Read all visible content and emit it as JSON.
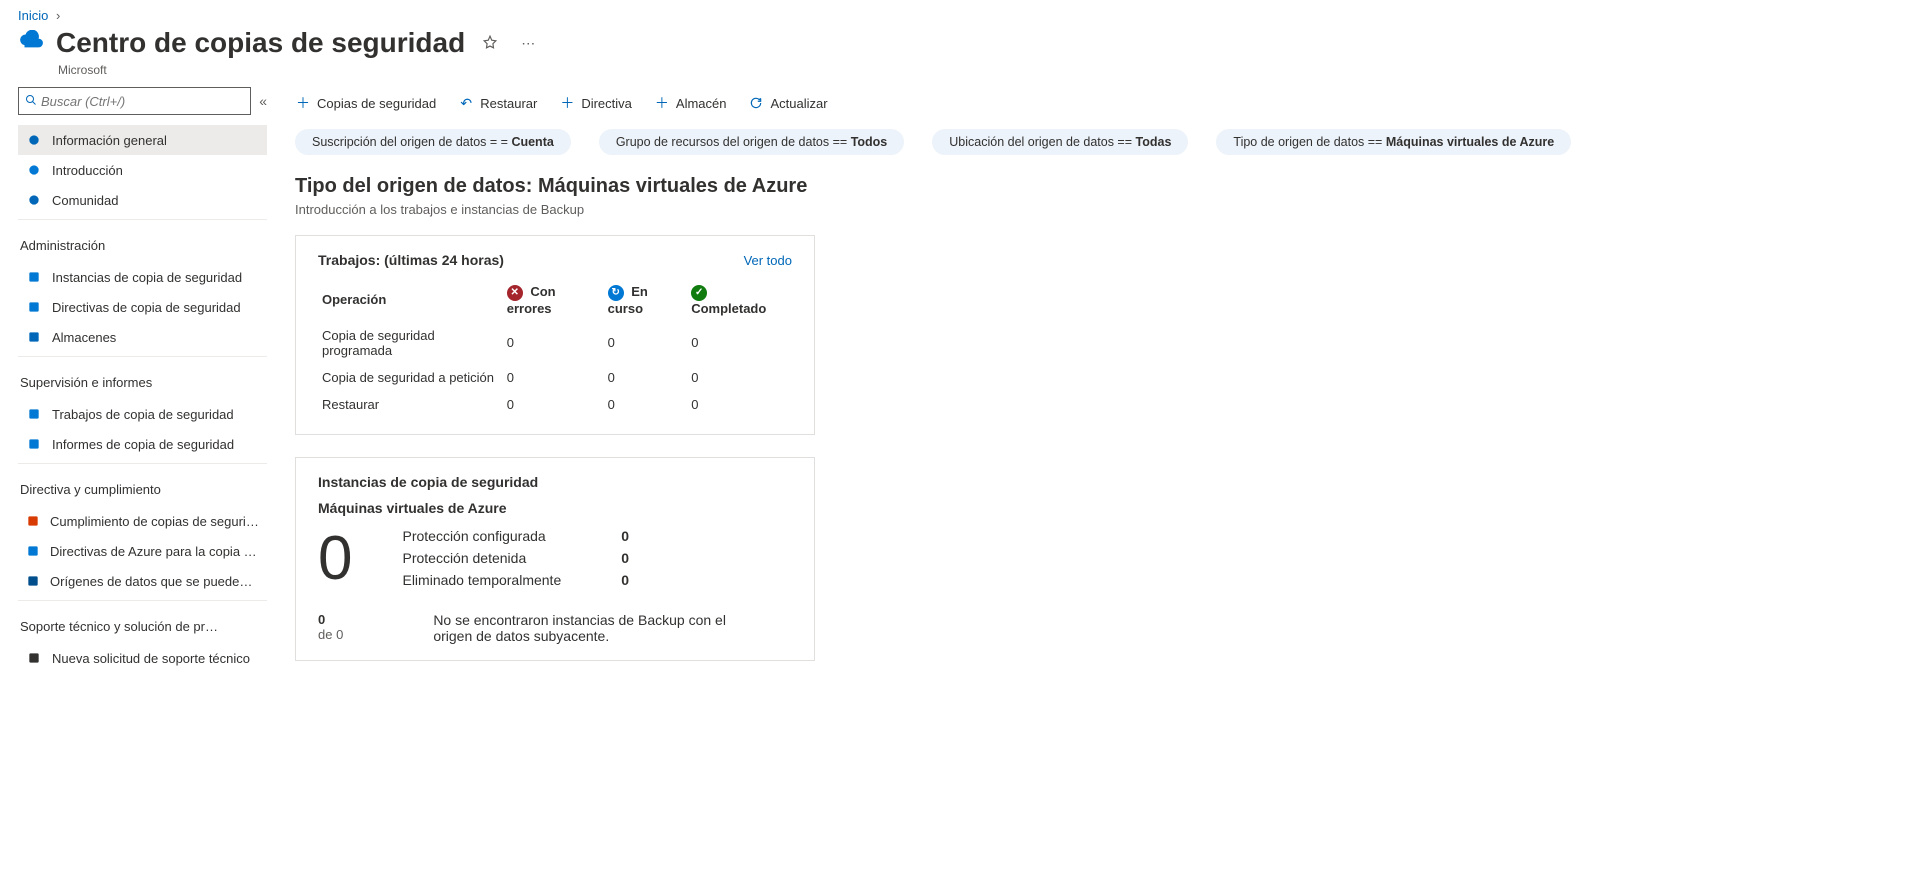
{
  "breadcrumb": {
    "home": "Inicio"
  },
  "header": {
    "title": "Centro de copias de seguridad",
    "subtitle": "Microsoft"
  },
  "searchPlaceholder": "Buscar (Ctrl+/)",
  "sidebar": {
    "items_top": [
      {
        "label": "Información general",
        "active": true,
        "icon": "#0067b8"
      },
      {
        "label": "Introducción",
        "icon": "#0078d4"
      },
      {
        "label": "Comunidad",
        "icon": "#0067b8"
      }
    ],
    "groups": [
      {
        "title": "Administración",
        "items": [
          {
            "label": "Instancias de copia de seguridad",
            "icon": "#0078d4"
          },
          {
            "label": "Directivas de copia de seguridad",
            "icon": "#0078d4"
          },
          {
            "label": "Almacenes",
            "icon": "#0067b8"
          }
        ]
      },
      {
        "title": "Supervisión e informes",
        "items": [
          {
            "label": "Trabajos de copia de seguridad",
            "icon": "#0078d4"
          },
          {
            "label": "Informes de copia de seguridad",
            "icon": "#0078d4"
          }
        ]
      },
      {
        "title": "Directiva y cumplimiento",
        "items": [
          {
            "label": "Cumplimiento de copias de seguridad para Azure",
            "icon": "#d83b01"
          },
          {
            "label": "Directivas de Azure para la copia de seguridad",
            "icon": "#0078d4"
          },
          {
            "label": "Orígenes de datos que se pueden proteger",
            "icon": "#004e8c"
          }
        ]
      },
      {
        "title": "Soporte técnico y solución de problemas",
        "items": [
          {
            "label": "Nueva solicitud de soporte técnico",
            "icon": "#323130"
          }
        ]
      }
    ]
  },
  "toolbar": {
    "backup": "Copias de seguridad",
    "restore": "Restaurar",
    "policy": "Directiva",
    "vault": "Almacén",
    "refresh": "Actualizar"
  },
  "filters": [
    {
      "label": "Suscripción del origen de datos = = ",
      "value": "Cuenta"
    },
    {
      "label": "Grupo de recursos del origen de datos == ",
      "value": "Todos"
    },
    {
      "label": "Ubicación del origen de datos == ",
      "value": "Todas"
    },
    {
      "label": "Tipo de origen de datos == ",
      "value": "Máquinas virtuales de Azure"
    }
  ],
  "section": {
    "title": "Tipo del origen de datos: Máquinas virtuales de Azure",
    "subtitle": "Introducción a los trabajos e instancias de Backup"
  },
  "jobsCard": {
    "title": "Trabajos: (últimas 24 horas)",
    "seeAll": "Ver todo",
    "opHeader": "Operación",
    "failed": "Con errores",
    "inProgress": "En curso",
    "completed": "Completado",
    "rows": [
      {
        "op": "Copia de seguridad programada",
        "failed": "0",
        "inprog": "0",
        "done": "0"
      },
      {
        "op": "Copia de seguridad a petición",
        "failed": "0",
        "inprog": "0",
        "done": "0"
      },
      {
        "op": "Restaurar",
        "failed": "0",
        "inprog": "0",
        "done": "0"
      }
    ]
  },
  "instancesCard": {
    "title": "Instancias de copia de seguridad",
    "subtitle": "Máquinas virtuales de Azure",
    "total": "0",
    "ofCount": "0",
    "ofLabel": "de 0",
    "rows": [
      {
        "label": "Protección configurada",
        "value": "0"
      },
      {
        "label": "Protección detenida",
        "value": "0"
      },
      {
        "label": "Eliminado temporalmente",
        "value": "0"
      }
    ],
    "footnote": "No se encontraron instancias de Backup con el origen de datos subyacente."
  }
}
